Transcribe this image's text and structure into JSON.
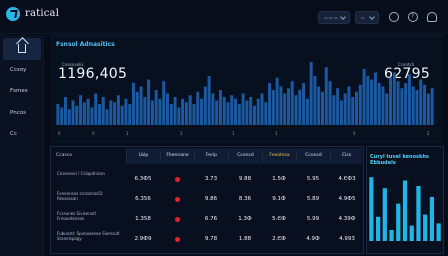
{
  "app": {
    "brand": "ratical"
  },
  "topbar": {
    "select_1": "▭ ▭ ▭",
    "select_2": "▭",
    "icons": [
      "user-icon",
      "help-icon",
      "bell-icon"
    ]
  },
  "sidebar": {
    "home_icon": "home-icon",
    "items": [
      "Ccsoy",
      "Fsmes",
      "Pncos",
      "Cc"
    ]
  },
  "overview": {
    "title": "Fsnsol Adnasitics",
    "left_label": "Cnesovolis",
    "left_value": "1196,405",
    "right_label": "Ccentsh",
    "right_value": "62795",
    "x_ticks": [
      "0",
      "0",
      "1",
      "2",
      "1",
      "1",
      "0",
      "2"
    ]
  },
  "chart_data": [
    {
      "type": "bar",
      "title": "",
      "values": [
        12,
        10,
        16,
        9,
        14,
        11,
        17,
        13,
        15,
        10,
        18,
        12,
        16,
        9,
        14,
        13,
        17,
        11,
        15,
        12,
        24,
        19,
        22,
        16,
        26,
        14,
        20,
        15,
        25,
        18,
        12,
        16,
        10,
        15,
        13,
        17,
        12,
        19,
        15,
        22,
        28,
        18,
        14,
        20,
        16,
        13,
        17,
        15,
        12,
        18,
        14,
        16,
        11,
        15,
        18,
        13,
        24,
        20,
        27,
        22,
        18,
        21,
        25,
        17,
        20,
        24,
        15,
        36,
        28,
        22,
        19,
        33,
        25,
        17,
        21,
        14,
        18,
        22,
        16,
        19,
        23,
        32,
        28,
        26,
        30,
        24,
        22,
        18,
        27,
        30,
        25,
        21,
        24,
        29,
        22,
        20,
        26,
        23,
        18,
        21
      ],
      "ylim": [
        0,
        40
      ],
      "color": "#1b5aa3"
    },
    {
      "type": "bar",
      "title": "Curyl tuvel kenoskhs Ebbudels",
      "values": [
        58,
        22,
        48,
        10,
        34,
        55,
        14,
        50,
        24,
        40,
        16
      ],
      "ylim": [
        0,
        60
      ],
      "color": "#1fb6e6"
    }
  ],
  "table": {
    "headers": [
      "Ccasco",
      "Lblp",
      "Fhennane",
      "Ferip",
      "Cconcd",
      "Feeatesa",
      "Cconcd",
      "Ciss"
    ],
    "rows": [
      {
        "label": "Cnessssei / Cslapdnicon",
        "cells": [
          "6.3Ф5",
          "",
          "3.73",
          "9.88",
          "1.5Ф",
          "5.95",
          "4.ЄФ3"
        ]
      },
      {
        "label": "Fonennsos srcasnlaciD Ressossan",
        "cells": [
          "6.356",
          "",
          "9.86",
          "8.36",
          "9.1Ф",
          "5.89",
          "4.9Ф5"
        ]
      },
      {
        "label": "Fcssunes Sivisenutl Fnrouetenson",
        "cells": [
          "1.358",
          "",
          "6.76",
          "1.3Ф",
          "5.ЄФ",
          "5.99",
          "4.39Ф"
        ]
      },
      {
        "label": "Fubunstl: Spvnoaesoe Siomsutl Sranelspagy",
        "cells": [
          "2.9Ф9",
          "",
          "9.78",
          "1.88",
          "2.ЄФ",
          "4.9Ф",
          "4.993"
        ]
      }
    ],
    "dot_color": "#e8232d",
    "accent_header": "#e8c54a"
  }
}
